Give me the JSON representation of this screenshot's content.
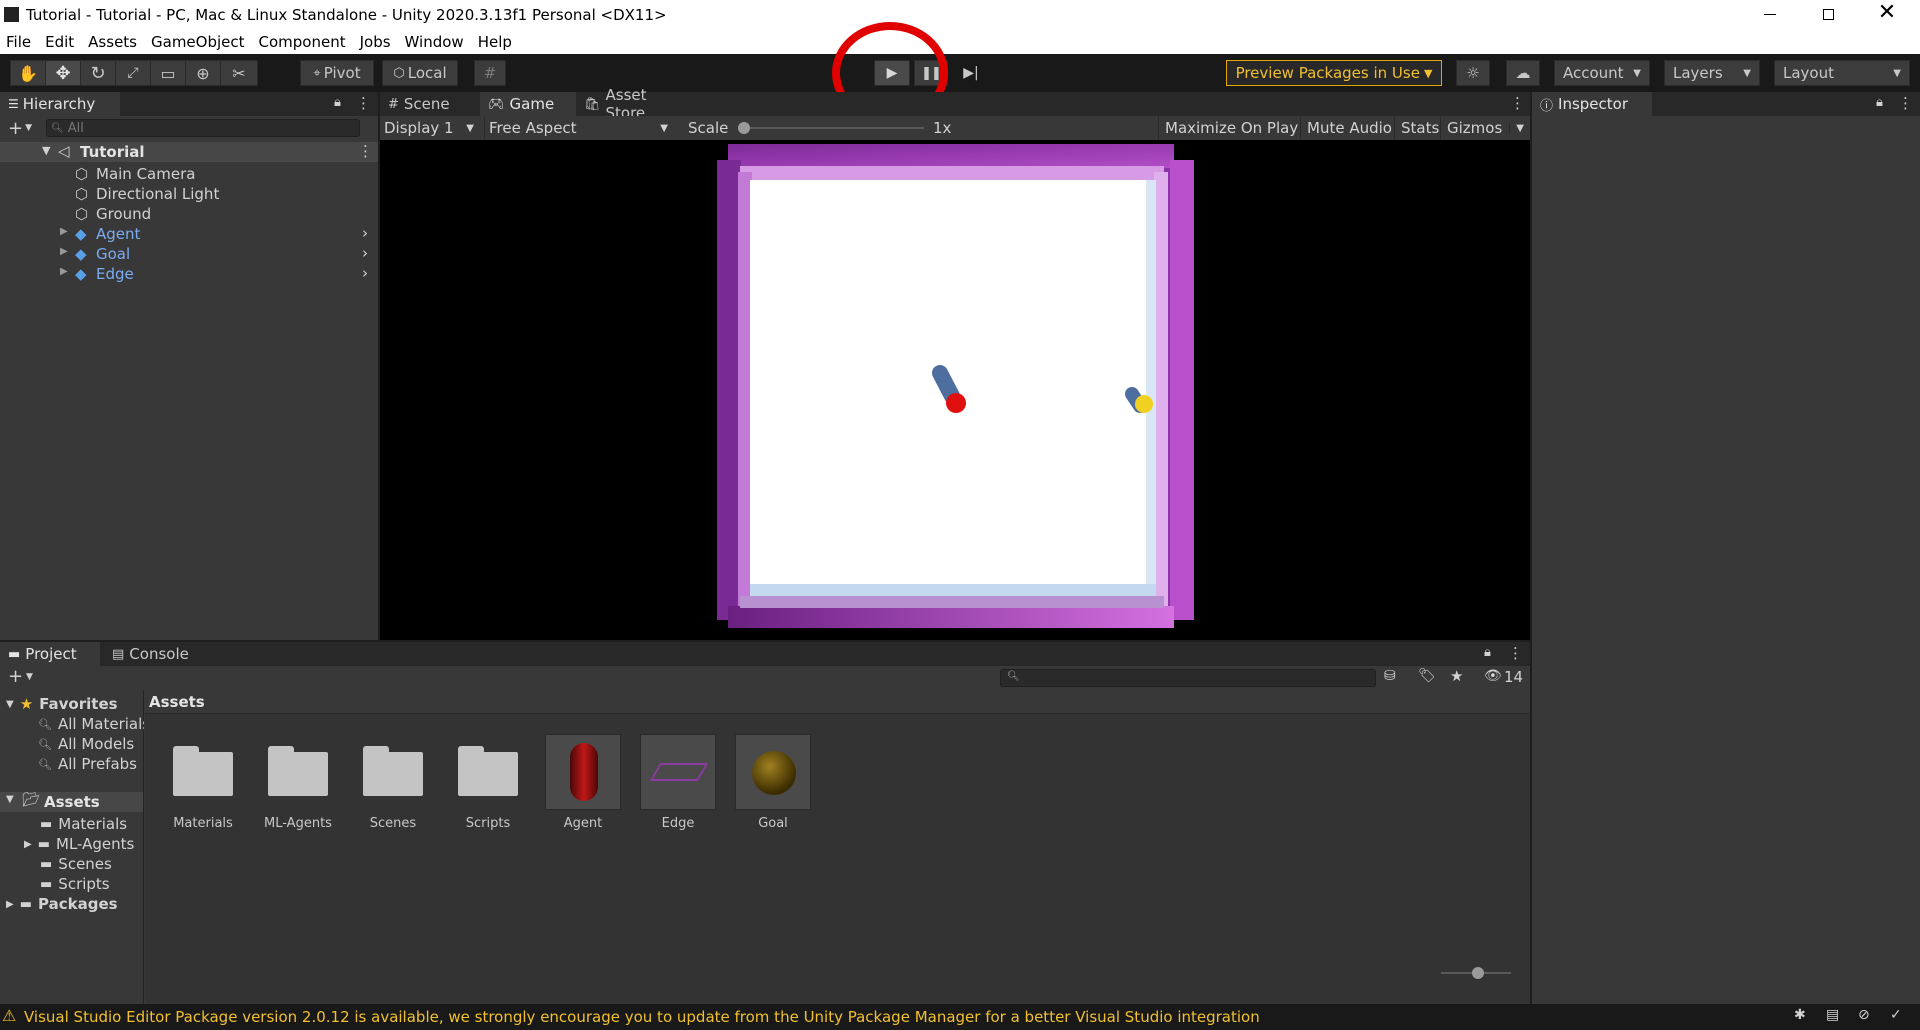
{
  "window": {
    "title": "Tutorial - Tutorial - PC, Mac & Linux Standalone - Unity 2020.3.13f1 Personal <DX11>",
    "minimize_icon": "minimize-icon",
    "restore_icon": "restore-icon",
    "close_icon": "close-icon"
  },
  "menu": [
    "File",
    "Edit",
    "Assets",
    "GameObject",
    "Component",
    "Jobs",
    "Window",
    "Help"
  ],
  "toolbar": {
    "pivot": "Pivot",
    "local": "Local",
    "preview_packages": "Preview Packages in Use",
    "account": "Account",
    "layers": "Layers",
    "layout": "Layout"
  },
  "hierarchy": {
    "tab": "Hierarchy",
    "search_placeholder": "All",
    "scene": "Tutorial",
    "items": [
      "Main Camera",
      "Directional Light",
      "Ground",
      "Agent",
      "Goal",
      "Edge"
    ]
  },
  "game_view": {
    "tabs": [
      "Scene",
      "Game",
      "Asset Store"
    ],
    "display": "Display 1",
    "aspect": "Free Aspect",
    "scale_label": "Scale",
    "scale_value": "1x",
    "maximize": "Maximize On Play",
    "mute": "Mute Audio",
    "stats": "Stats",
    "gizmos": "Gizmos"
  },
  "inspector": {
    "tab": "Inspector"
  },
  "project": {
    "tabs": [
      "Project",
      "Console"
    ],
    "hidden_count": "14",
    "breadcrumb": "Assets",
    "favorites": {
      "label": "Favorites",
      "items": [
        "All Materials",
        "All Models",
        "All Prefabs"
      ]
    },
    "assets_tree": {
      "label": "Assets",
      "items": [
        "Materials",
        "ML-Agents",
        "Scenes",
        "Scripts"
      ]
    },
    "packages": "Packages",
    "grid": [
      "Materials",
      "ML-Agents",
      "Scenes",
      "Scripts",
      "Agent",
      "Edge",
      "Goal"
    ]
  },
  "status": {
    "message": "Visual Studio Editor Package version 2.0.12 is available, we strongly encourage you to update from the Unity Package Manager for a better Visual Studio integration"
  },
  "colors": {
    "accent_annotation": "#e00000",
    "preview_border": "#e0a800",
    "agent_red": "#e01010",
    "goal_yellow": "#f0d020",
    "edge_purple": "#a040c0"
  }
}
